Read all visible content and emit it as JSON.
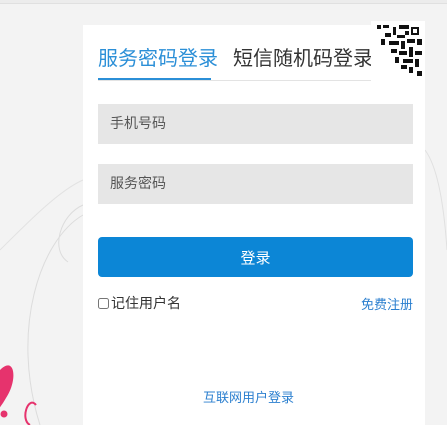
{
  "tabs": {
    "service_password": "服务密码登录",
    "sms_code": "短信随机码登录"
  },
  "form": {
    "phone_placeholder": "手机号码",
    "password_placeholder": "服务密码",
    "login_button": "登录",
    "remember_label": "记住用户名",
    "register_link": "免费注册",
    "internet_login_link": "互联网用户登录"
  },
  "colors": {
    "accent": "#2b8fd7",
    "button": "#0c86d6",
    "field_bg": "#e6e6e6",
    "decoration_pink": "#e6336d"
  },
  "icons": [
    "qr-code-icon"
  ]
}
